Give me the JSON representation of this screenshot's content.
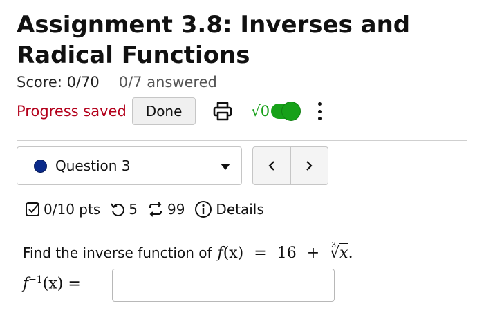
{
  "header": {
    "title": "Assignment 3.8: Inverses and Radical Functions"
  },
  "score": {
    "label": "Score: 0/70",
    "answered": "0/7 answered"
  },
  "status": {
    "progress_text": "Progress saved",
    "done_label": "Done",
    "print_icon": "print-icon",
    "math_toggle_glyph": "√0",
    "math_toggle_on": true,
    "more_icon": "more-vertical-icon"
  },
  "question_nav": {
    "selected": "Question 3",
    "prev_label": "<",
    "next_label": ">"
  },
  "question_info": {
    "points": "0/10 pts",
    "attempts": "5",
    "submissions": "99",
    "details_label": "Details"
  },
  "problem": {
    "prompt": "Find the inverse function of",
    "f_name": "f",
    "f_arg": "(x)",
    "equals": "=",
    "constant": "16",
    "plus": "+",
    "root_index": "3",
    "radicand": "x",
    "end_period": ".",
    "answer_f": "f",
    "answer_sup": "−1",
    "answer_arg": "(x) =",
    "answer_value": ""
  },
  "colors": {
    "progress_saved": "#b3001b",
    "toggle_green": "#17a119",
    "question_dot": "#0a2a8a",
    "border": "#c6c6c6"
  }
}
